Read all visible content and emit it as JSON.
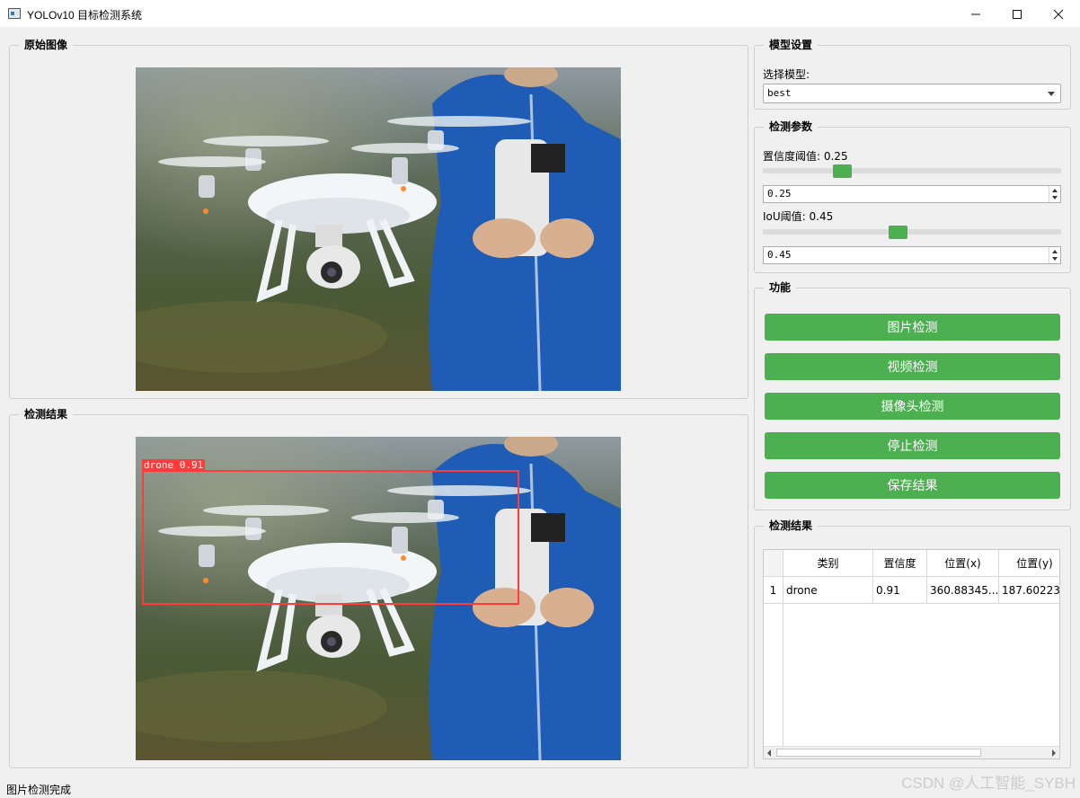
{
  "window": {
    "title": "YOLOv10 目标检测系统"
  },
  "original_panel": {
    "title": "原始图像"
  },
  "result_panel": {
    "title": "检测结果",
    "detection_label": "drone 0.91"
  },
  "model_settings": {
    "title": "模型设置",
    "select_label": "选择模型:",
    "selected_model": "best"
  },
  "detection_params": {
    "title": "检测参数",
    "confidence_label": "置信度阈值: 0.25",
    "confidence_value": "0.25",
    "confidence_level": 0.25,
    "iou_label": "IoU阈值: 0.45",
    "iou_value": "0.45",
    "iou_level": 0.45
  },
  "functions": {
    "title": "功能",
    "buttons": [
      "图片检测",
      "视频检测",
      "摄像头检测",
      "停止检测",
      "保存结果"
    ]
  },
  "results_table": {
    "title": "检测结果",
    "headers": [
      "类别",
      "置信度",
      "位置(x)",
      "位置(y)"
    ],
    "rows": [
      {
        "index": "1",
        "cells": [
          "drone",
          "0.91",
          "360.88345...",
          "187.60223..."
        ]
      }
    ]
  },
  "status": {
    "text": "图片检测完成"
  },
  "watermark": "CSDN @人工智能_SYBH",
  "colors": {
    "accent_green": "#4caf50",
    "detection_red": "#ff3b3b",
    "coat_blue": "#1f5cb5"
  }
}
